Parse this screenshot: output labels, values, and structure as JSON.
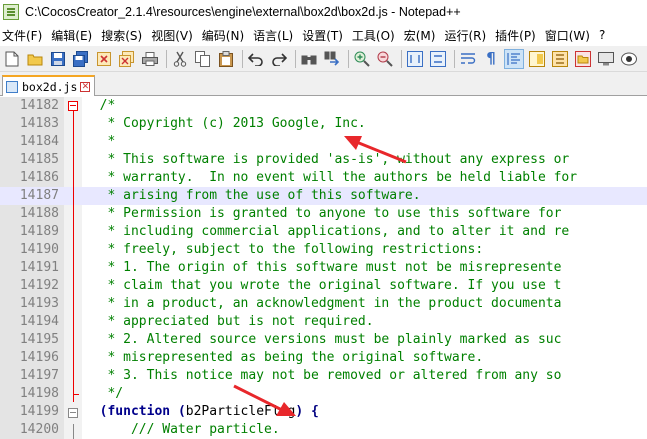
{
  "window": {
    "title": "C:\\CocosCreator_2.1.4\\resources\\engine\\external\\box2d\\box2d.js - Notepad++"
  },
  "menu": {
    "items": [
      "文件(F)",
      "编辑(E)",
      "搜索(S)",
      "视图(V)",
      "编码(N)",
      "语言(L)",
      "设置(T)",
      "工具(O)",
      "宏(M)",
      "运行(R)",
      "插件(P)",
      "窗口(W)",
      "?"
    ]
  },
  "toolbar": {
    "icons": [
      "new-file-icon",
      "open-file-icon",
      "save-icon",
      "save-all-icon",
      "close-icon",
      "close-all-icon",
      "print-icon",
      "cut-icon",
      "copy-icon",
      "paste-icon",
      "undo-icon",
      "redo-icon",
      "find-icon",
      "replace-icon",
      "zoom-in-icon",
      "zoom-out-icon",
      "sync-vertical-icon",
      "sync-horizontal-icon",
      "word-wrap-icon",
      "show-all-chars-icon",
      "indent-guide-icon",
      "doc-map-icon",
      "function-list-icon",
      "folder-as-workspace-icon",
      "monitor-icon",
      "record-macro-icon"
    ]
  },
  "tabs": [
    {
      "label": "box2d.js",
      "active": true
    }
  ],
  "editor": {
    "lines": [
      {
        "num": "14182",
        "text": "  /*"
      },
      {
        "num": "14183",
        "text": "   * Copyright (c) 2013 Google, Inc."
      },
      {
        "num": "14184",
        "text": "   *"
      },
      {
        "num": "14185",
        "text": "   * This software is provided 'as-is', without any express or"
      },
      {
        "num": "14186",
        "text": "   * warranty.  In no event will the authors be held liable for"
      },
      {
        "num": "14187",
        "text": "   * arising from the use of this software.",
        "current": true
      },
      {
        "num": "14188",
        "text": "   * Permission is granted to anyone to use this software for"
      },
      {
        "num": "14189",
        "text": "   * including commercial applications, and to alter it and re"
      },
      {
        "num": "14190",
        "text": "   * freely, subject to the following restrictions:"
      },
      {
        "num": "14191",
        "text": "   * 1. The origin of this software must not be misrepresente"
      },
      {
        "num": "14192",
        "text": "   * claim that you wrote the original software. If you use t"
      },
      {
        "num": "14193",
        "text": "   * in a product, an acknowledgment in the product documenta"
      },
      {
        "num": "14194",
        "text": "   * appreciated but is not required."
      },
      {
        "num": "14195",
        "text": "   * 2. Altered source versions must be plainly marked as suc"
      },
      {
        "num": "14196",
        "text": "   * misrepresented as being the original software."
      },
      {
        "num": "14197",
        "text": "   * 3. This notice may not be removed or altered from any so"
      },
      {
        "num": "14198",
        "text": "   */"
      },
      {
        "num": "14199",
        "kw1": "(function",
        "sp1": " ",
        "op1": "(",
        "id1": "b2ParticleFlag",
        "op2": ")",
        "sp2": " ",
        "op3": "{"
      },
      {
        "num": "14200",
        "text": "      /// Water particle."
      }
    ]
  },
  "colors": {
    "comment": "#008000",
    "keyword": "#00008b",
    "line_number": "#808080",
    "current_line": "#e8e8ff",
    "fold_marker": "#e00000",
    "annotation_arrow": "#e8272b"
  }
}
